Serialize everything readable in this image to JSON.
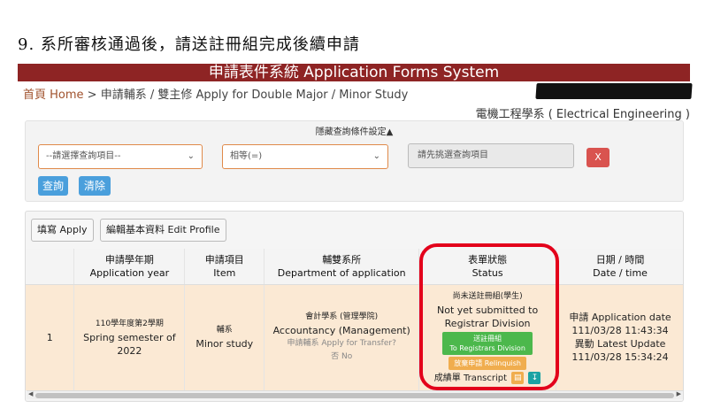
{
  "step_title": "9. 系所審核通過後，請送註冊組完成後續申請",
  "banner_title": "申請表件系統 Application Forms System",
  "breadcrumb": {
    "home": "首頁 Home",
    "separator": ">",
    "current": "申請輔系 / 雙主修 Apply for Double Major / Minor Study"
  },
  "department": "電機工程學系 ( Electrical Engineering )",
  "query_panel": {
    "toggle_label": "隱藏查詢條件設定▲",
    "field_select": "--請選擇查詢項目--",
    "operator_select": "相等(=)",
    "value_placeholder": "請先挑選查詢項目",
    "clear_x": "X",
    "query_button": "查詢",
    "clear_button": "清除"
  },
  "toolbar": {
    "apply_button": "填寫 Apply",
    "edit_profile_button": "編輯基本資料 Edit Profile"
  },
  "table": {
    "headers": [
      {
        "zh": "",
        "en": ""
      },
      {
        "zh": "申請學年期",
        "en": "Application year"
      },
      {
        "zh": "申請項目",
        "en": "Item"
      },
      {
        "zh": "輔雙系所",
        "en": "Department of application"
      },
      {
        "zh": "表單狀態",
        "en": "Status"
      },
      {
        "zh": "日期 / 時間",
        "en": "Date / time"
      }
    ],
    "rows": [
      {
        "index": "1",
        "year_zh": "110學年度第2學期",
        "year_en": "Spring semester of 2022",
        "item_zh": "輔系",
        "item_en": "Minor study",
        "dept_zh": "會計學系 (管理學院)",
        "dept_en": "Accountancy (Management)",
        "transfer_q": "申請輔系 Apply for Transfer?",
        "transfer_a": "否 No",
        "status_zh": "尚未送註冊組(學生)",
        "status_en1": "Not yet submitted to",
        "status_en2": "Registrar Division",
        "btn_send_zh": "送註冊組",
        "btn_send_en": "To Registrars Division",
        "btn_relinquish": "放棄申請 Relinquish",
        "transcript_label": "成績單 Transcript",
        "app_date_label": "申請 Application date",
        "app_date": "111/03/28 11:43:34",
        "update_label": "異動 Latest Update",
        "update_date": "111/03/28 15:34:24"
      }
    ]
  },
  "colors": {
    "banner": "#8e2424",
    "row_bg": "#fbe9d4",
    "highlight": "#e3001b",
    "primary_btn": "#4a9fdc",
    "danger_btn": "#d9534f",
    "success_btn": "#4cb84c",
    "warning_btn": "#f0ad4e"
  }
}
